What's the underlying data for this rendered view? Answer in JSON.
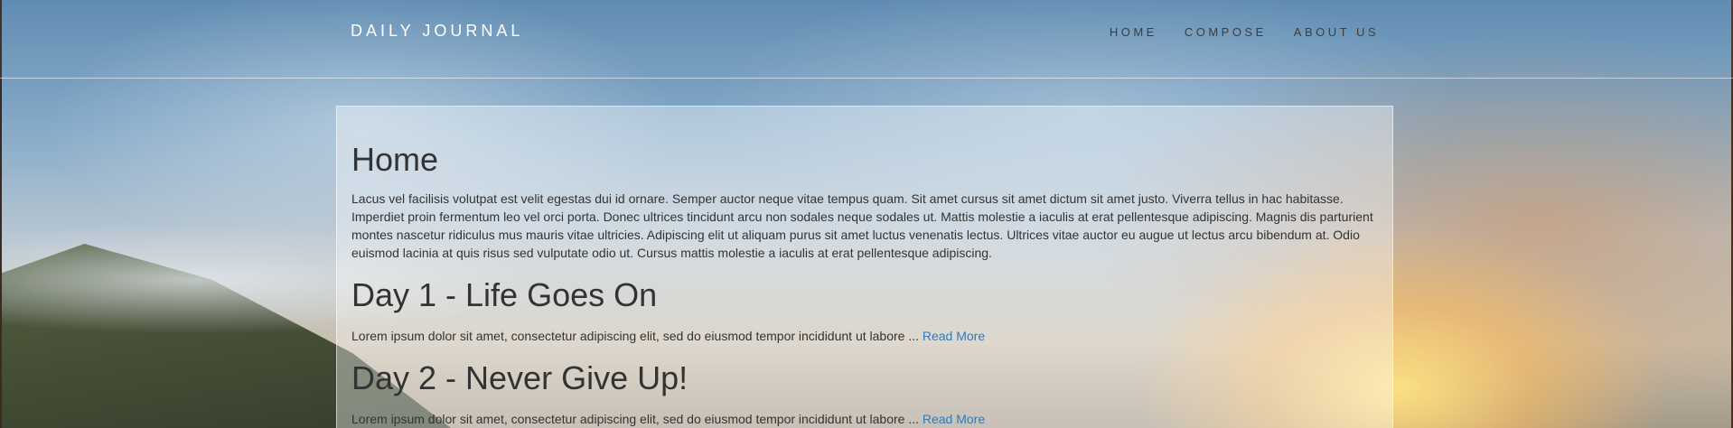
{
  "header": {
    "brand": "DAILY JOURNAL",
    "nav": [
      "HOME",
      "COMPOSE",
      "ABOUT US"
    ]
  },
  "main": {
    "title": "Home",
    "intro": "Lacus vel facilisis volutpat est velit egestas dui id ornare. Semper auctor neque vitae tempus quam. Sit amet cursus sit amet dictum sit amet justo. Viverra tellus in hac habitasse. Imperdiet proin fermentum leo vel orci porta. Donec ultrices tincidunt arcu non sodales neque sodales ut. Mattis molestie a iaculis at erat pellentesque adipiscing. Magnis dis parturient montes nascetur ridiculus mus mauris vitae ultricies. Adipiscing elit ut aliquam purus sit amet luctus venenatis lectus. Ultrices vitae auctor eu augue ut lectus arcu bibendum at. Odio euismod lacinia at quis risus sed vulputate odio ut. Cursus mattis molestie a iaculis at erat pellentesque adipiscing.",
    "posts": [
      {
        "title": "Day 1 - Life Goes On",
        "excerpt": "Lorem ipsum dolor sit amet, consectetur adipiscing elit, sed do eiusmod tempor incididunt ut labore ...",
        "link": "Read More"
      },
      {
        "title": "Day 2 - Never Give Up!",
        "excerpt": "Lorem ipsum dolor sit amet, consectetur adipiscing elit, sed do eiusmod tempor incididunt ut labore ...",
        "link": "Read More"
      }
    ]
  },
  "colors": {
    "link": "#337ab7",
    "text": "#333333",
    "brand": "#ffffff"
  }
}
